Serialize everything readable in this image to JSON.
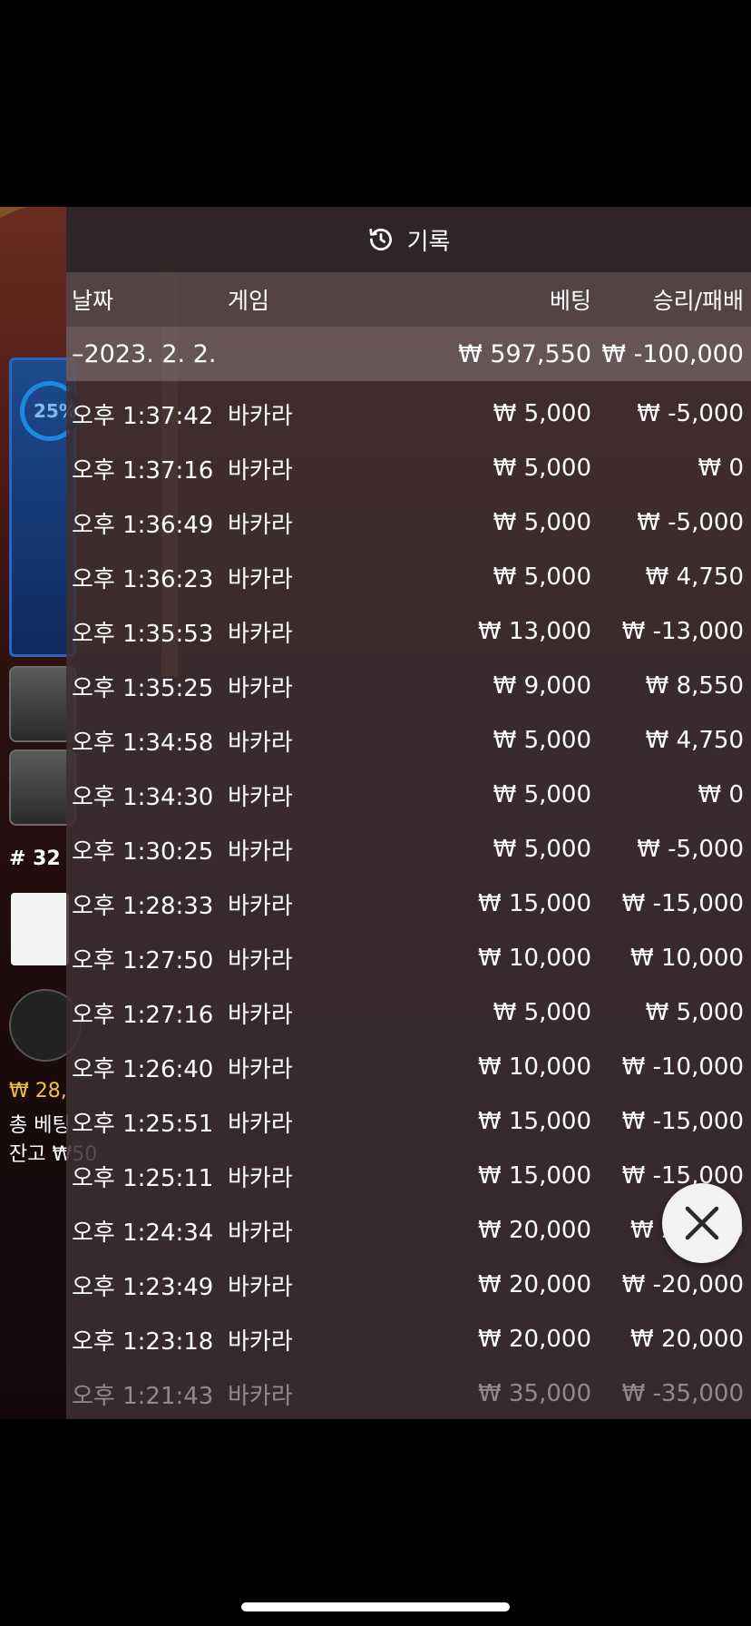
{
  "header": {
    "title": "기록",
    "icon": "history-icon"
  },
  "columns": {
    "date": "날짜",
    "game": "게임",
    "bet": "베팅",
    "win_loss": "승리/패배"
  },
  "summary": {
    "date": "–2023. 2. 2.",
    "bet": "₩ 597,550",
    "win_loss": "₩ -100,000"
  },
  "rows": [
    {
      "time": "오후 1:37:42",
      "game": "바카라",
      "bet": "₩ 5,000",
      "result": "₩ -5,000"
    },
    {
      "time": "오후 1:37:16",
      "game": "바카라",
      "bet": "₩ 5,000",
      "result": "₩ 0"
    },
    {
      "time": "오후 1:36:49",
      "game": "바카라",
      "bet": "₩ 5,000",
      "result": "₩ -5,000"
    },
    {
      "time": "오후 1:36:23",
      "game": "바카라",
      "bet": "₩ 5,000",
      "result": "₩ 4,750"
    },
    {
      "time": "오후 1:35:53",
      "game": "바카라",
      "bet": "₩ 13,000",
      "result": "₩ -13,000"
    },
    {
      "time": "오후 1:35:25",
      "game": "바카라",
      "bet": "₩ 9,000",
      "result": "₩ 8,550"
    },
    {
      "time": "오후 1:34:58",
      "game": "바카라",
      "bet": "₩ 5,000",
      "result": "₩ 4,750"
    },
    {
      "time": "오후 1:34:30",
      "game": "바카라",
      "bet": "₩ 5,000",
      "result": "₩ 0"
    },
    {
      "time": "오후 1:30:25",
      "game": "바카라",
      "bet": "₩ 5,000",
      "result": "₩ -5,000"
    },
    {
      "time": "오후 1:28:33",
      "game": "바카라",
      "bet": "₩ 15,000",
      "result": "₩ -15,000"
    },
    {
      "time": "오후 1:27:50",
      "game": "바카라",
      "bet": "₩ 10,000",
      "result": "₩ 10,000"
    },
    {
      "time": "오후 1:27:16",
      "game": "바카라",
      "bet": "₩ 5,000",
      "result": "₩ 5,000"
    },
    {
      "time": "오후 1:26:40",
      "game": "바카라",
      "bet": "₩ 10,000",
      "result": "₩ -10,000"
    },
    {
      "time": "오후 1:25:51",
      "game": "바카라",
      "bet": "₩ 15,000",
      "result": "₩ -15,000"
    },
    {
      "time": "오후 1:25:11",
      "game": "바카라",
      "bet": "₩ 15,000",
      "result": "₩ -15,000"
    },
    {
      "time": "오후 1:24:34",
      "game": "바카라",
      "bet": "₩ 20,000",
      "result": "₩ 20,000"
    },
    {
      "time": "오후 1:23:49",
      "game": "바카라",
      "bet": "₩ 20,000",
      "result": "₩ -20,000"
    },
    {
      "time": "오후 1:23:18",
      "game": "바카라",
      "bet": "₩ 20,000",
      "result": "₩ 20,000"
    },
    {
      "time": "오후 1:21:43",
      "game": "바카라",
      "bet": "₩ 35,000",
      "result": "₩ -35,000"
    }
  ],
  "background": {
    "progress_label": "25%",
    "round_label": "# 32",
    "balance_partial": "₩ 28,",
    "total_bet_partial": "총 베팅",
    "balance_label_partial": "잔고 ₩",
    "balance_value_partial": "50"
  },
  "close_button": {
    "icon": "close-icon"
  },
  "colors": {
    "panel_bg": "#3e2e32",
    "gold": "#f0c040",
    "text": "#ffffff"
  }
}
